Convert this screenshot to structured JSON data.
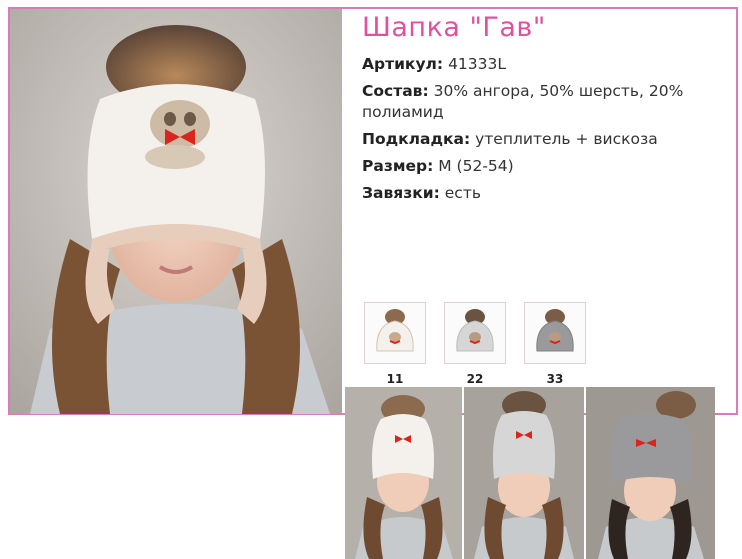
{
  "product": {
    "title": "Шапка \"Гав\"",
    "article_label": "Артикул:",
    "article_value": "41333L",
    "composition_label": "Состав:",
    "composition_value": "30% ангора, 50% шерсть, 20% полиамид",
    "lining_label": "Подкладка:",
    "lining_value": "утеплитель + вискоза",
    "size_label": "Размер:",
    "size_value": "M (52-54)",
    "ties_label": "Завязки:",
    "ties_value": "есть"
  },
  "color_variants": [
    {
      "code": "11",
      "hat_color": "#f4f1ec"
    },
    {
      "code": "22",
      "hat_color": "#d6d6d6"
    },
    {
      "code": "33",
      "hat_color": "#9a9a9c"
    }
  ],
  "colors": {
    "accent": "#e0509c",
    "frame": "#d87bbf"
  }
}
